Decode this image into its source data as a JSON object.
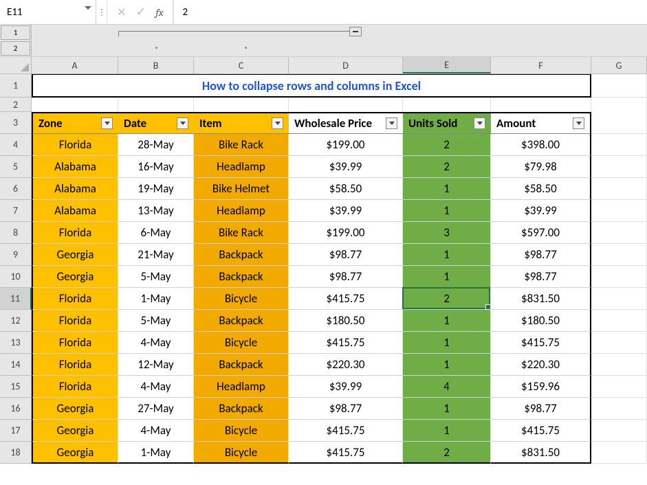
{
  "formula_bar": {
    "name_box": "E11",
    "fx_label": "fx",
    "formula_value": "2"
  },
  "outline": {
    "levels": [
      "1",
      "2"
    ]
  },
  "columns": [
    "A",
    "B",
    "C",
    "D",
    "E",
    "F",
    "G"
  ],
  "title": "How to collapse rows and columns in Excel",
  "headers": {
    "zone": "Zone",
    "date": "Date",
    "item": "Item",
    "price": "Wholesale Price",
    "units": "Units Sold",
    "amount": "Amount"
  },
  "row_numbers": [
    "1",
    "2",
    "3",
    "4",
    "5",
    "6",
    "7",
    "8",
    "9",
    "10",
    "11",
    "12",
    "13",
    "14",
    "15",
    "16",
    "17",
    "18"
  ],
  "rows": [
    {
      "zone": "Florida",
      "date": "28-May",
      "item": "Bike Rack",
      "price": "$199.00",
      "units": "2",
      "amount": "$398.00"
    },
    {
      "zone": "Alabama",
      "date": "16-May",
      "item": "Headlamp",
      "price": "$39.99",
      "units": "2",
      "amount": "$79.98"
    },
    {
      "zone": "Alabama",
      "date": "19-May",
      "item": "Bike Helmet",
      "price": "$58.50",
      "units": "1",
      "amount": "$58.50"
    },
    {
      "zone": "Alabama",
      "date": "13-May",
      "item": "Headlamp",
      "price": "$39.99",
      "units": "1",
      "amount": "$39.99"
    },
    {
      "zone": "Florida",
      "date": "6-May",
      "item": "Bike Rack",
      "price": "$199.00",
      "units": "3",
      "amount": "$597.00"
    },
    {
      "zone": "Georgia",
      "date": "21-May",
      "item": "Backpack",
      "price": "$98.77",
      "units": "1",
      "amount": "$98.77"
    },
    {
      "zone": "Georgia",
      "date": "5-May",
      "item": "Backpack",
      "price": "$98.77",
      "units": "1",
      "amount": "$98.77"
    },
    {
      "zone": "Florida",
      "date": "1-May",
      "item": "Bicycle",
      "price": "$415.75",
      "units": "2",
      "amount": "$831.50"
    },
    {
      "zone": "Florida",
      "date": "5-May",
      "item": "Backpack",
      "price": "$180.50",
      "units": "1",
      "amount": "$180.50"
    },
    {
      "zone": "Florida",
      "date": "4-May",
      "item": "Bicycle",
      "price": "$415.75",
      "units": "1",
      "amount": "$415.75"
    },
    {
      "zone": "Florida",
      "date": "12-May",
      "item": "Backpack",
      "price": "$220.30",
      "units": "1",
      "amount": "$220.30"
    },
    {
      "zone": "Florida",
      "date": "4-May",
      "item": "Headlamp",
      "price": "$39.99",
      "units": "4",
      "amount": "$159.96"
    },
    {
      "zone": "Georgia",
      "date": "27-May",
      "item": "Backpack",
      "price": "$98.77",
      "units": "1",
      "amount": "$98.77"
    },
    {
      "zone": "Georgia",
      "date": "4-May",
      "item": "Bicycle",
      "price": "$415.75",
      "units": "1",
      "amount": "$415.75"
    },
    {
      "zone": "Georgia",
      "date": "1-May",
      "item": "Bicycle",
      "price": "$415.75",
      "units": "2",
      "amount": "$831.50"
    }
  ],
  "selected_cell": "E11"
}
